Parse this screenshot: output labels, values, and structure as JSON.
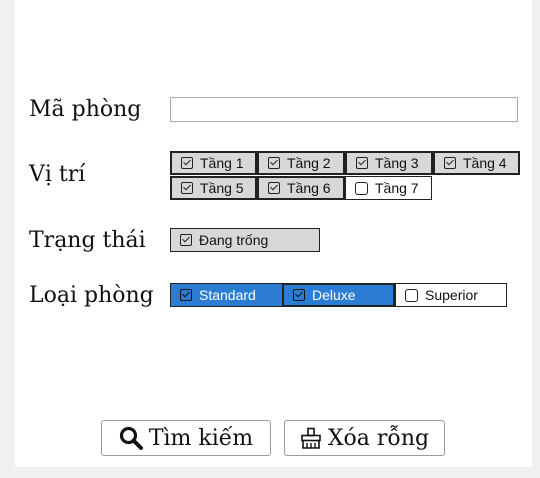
{
  "form": {
    "room_code": {
      "label": "Mã phòng",
      "value": "",
      "placeholder": ""
    },
    "location": {
      "label": "Vị trí",
      "options": [
        {
          "label": "Tầng 1",
          "checked": true
        },
        {
          "label": "Tầng 2",
          "checked": true
        },
        {
          "label": "Tầng 3",
          "checked": true
        },
        {
          "label": "Tầng 4",
          "checked": true
        },
        {
          "label": "Tầng 5",
          "checked": true
        },
        {
          "label": "Tầng 6",
          "checked": true
        },
        {
          "label": "Tầng 7",
          "checked": false
        }
      ]
    },
    "status": {
      "label": "Trạng thái",
      "options": [
        {
          "label": "Đang trống",
          "checked": true
        }
      ]
    },
    "room_type": {
      "label": "Loại phòng",
      "options": [
        {
          "label": "Standard",
          "checked": true
        },
        {
          "label": "Deluxe",
          "checked": true
        },
        {
          "label": "Superior",
          "checked": false
        }
      ]
    }
  },
  "actions": {
    "search_label": "Tìm kiếm",
    "clear_label": "Xóa rỗng"
  },
  "colors": {
    "selected_blue": "#2b7cd3",
    "checked_gray": "#d8d8d8",
    "background": "#f0f0f0"
  },
  "icons": {
    "search": "search-icon",
    "clear": "eraser-icon"
  }
}
